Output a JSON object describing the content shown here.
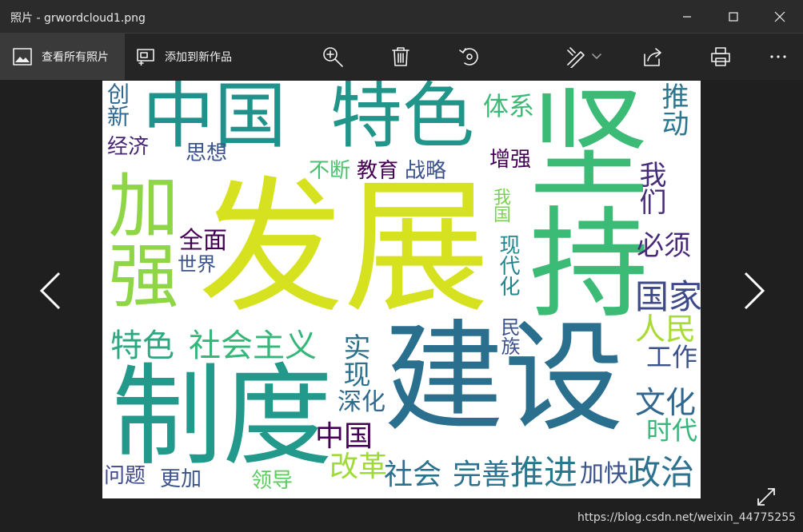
{
  "window": {
    "title": "照片 - grwordcloud1.png"
  },
  "toolbar": {
    "view_all_label": "查看所有照片",
    "add_to_creation_label": "添加到新作品"
  },
  "wordcloud": {
    "words": [
      {
        "text": "发展",
        "color": "#d6e21f"
      },
      {
        "text": "坚持",
        "color": "#3bbb75"
      },
      {
        "text": "建设",
        "color": "#2a6f8e"
      },
      {
        "text": "制度",
        "color": "#22998b"
      },
      {
        "text": "中国",
        "color": "#21918c"
      },
      {
        "text": "特色",
        "color": "#21958a"
      },
      {
        "text": "加强",
        "color": "#8ed645"
      },
      {
        "text": "特色",
        "color": "#2fa882"
      },
      {
        "text": "社会主义",
        "color": "#35b779"
      },
      {
        "text": "国家",
        "color": "#3e4989"
      },
      {
        "text": "人民",
        "color": "#a8db34"
      },
      {
        "text": "工作",
        "color": "#3b528b"
      },
      {
        "text": "文化",
        "color": "#31668e"
      },
      {
        "text": "时代",
        "color": "#35b779"
      },
      {
        "text": "社会",
        "color": "#2c728e"
      },
      {
        "text": "完善",
        "color": "#2c728e"
      },
      {
        "text": "推进",
        "color": "#2a788e"
      },
      {
        "text": "加快",
        "color": "#3b528b"
      },
      {
        "text": "政治",
        "color": "#2c728e"
      },
      {
        "text": "改革",
        "color": "#a0da39"
      },
      {
        "text": "中国",
        "color": "#440154"
      },
      {
        "text": "领导",
        "color": "#5ec962"
      },
      {
        "text": "更加",
        "color": "#3b528b"
      },
      {
        "text": "问题",
        "color": "#3e4a89"
      },
      {
        "text": "深化",
        "color": "#31688e"
      },
      {
        "text": "实现",
        "color": "#2c728e"
      },
      {
        "text": "民族",
        "color": "#3b528b"
      },
      {
        "text": "现代化",
        "color": "#25858e"
      },
      {
        "text": "我国",
        "color": "#7ad151"
      },
      {
        "text": "必须",
        "color": "#482878"
      },
      {
        "text": "我们",
        "color": "#472c7a"
      },
      {
        "text": "推动",
        "color": "#2a768e"
      },
      {
        "text": "增强",
        "color": "#440154"
      },
      {
        "text": "体系",
        "color": "#3aba76"
      },
      {
        "text": "教育",
        "color": "#440154"
      },
      {
        "text": "战略",
        "color": "#3b528b"
      },
      {
        "text": "不断",
        "color": "#4ac16d"
      },
      {
        "text": "思想",
        "color": "#3b528b"
      },
      {
        "text": "经济",
        "color": "#482475"
      },
      {
        "text": "创新",
        "color": "#31688e"
      },
      {
        "text": "全面",
        "color": "#440154"
      },
      {
        "text": "世界",
        "color": "#3b528b"
      }
    ]
  },
  "watermark": "https://blog.csdn.net/weixin_44775255"
}
